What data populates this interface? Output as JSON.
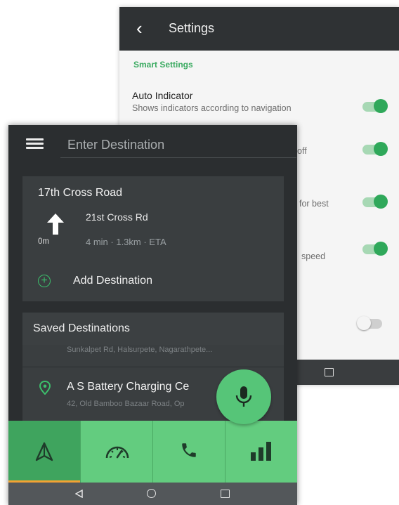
{
  "settings": {
    "title": "Settings",
    "section": "Smart Settings",
    "items": [
      {
        "title": "Auto Indicator",
        "subtitle": "Shows indicators according to navigation",
        "on": true
      },
      {
        "subtitle": "off",
        "on": true
      },
      {
        "subtitle": "for best",
        "on": true
      },
      {
        "subtitle": "speed",
        "on": true
      },
      {
        "on": false
      }
    ]
  },
  "nav": {
    "search_placeholder": "Enter Destination",
    "route": {
      "title": "17th Cross Road",
      "street": "21st Cross Rd",
      "distance": "0m",
      "eta": "4 min · 1.3km · ETA",
      "add_destination": "Add Destination"
    },
    "saved": {
      "title": "Saved Destinations",
      "items": [
        {
          "address": "Sunkalpet Rd, Halsurpete, Nagarathpete..."
        },
        {
          "name": "A S Battery Charging Ce",
          "address": "42, Old Bamboo Bazaar Road, Op"
        }
      ]
    },
    "tabs": [
      {
        "icon": "navigation-arrow-icon",
        "active": true
      },
      {
        "icon": "speedometer-icon",
        "active": false
      },
      {
        "icon": "phone-icon",
        "active": false
      },
      {
        "icon": "signal-bars-icon",
        "active": false
      }
    ]
  },
  "colors": {
    "accent_green": "#3cab62",
    "tab_green": "#63cc7f",
    "tab_active": "#3fa45e",
    "indicator_orange": "#f3a233",
    "dark_bg": "#2b2e30"
  }
}
